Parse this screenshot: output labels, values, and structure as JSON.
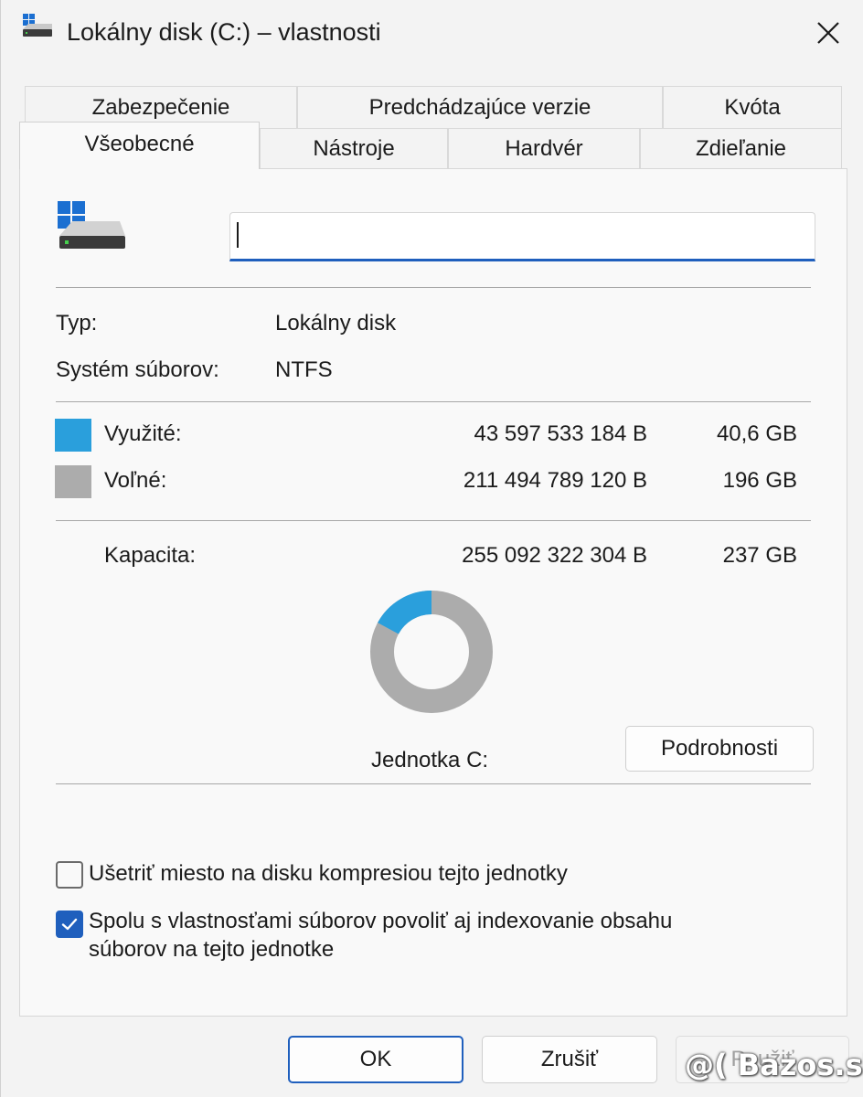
{
  "window": {
    "title": "Lokálny disk (C:) – vlastnosti"
  },
  "tabs": {
    "row1": [
      "Zabezpečenie",
      "Predchádzajúce verzie",
      "Kvóta"
    ],
    "row2": [
      "Všeobecné",
      "Nástroje",
      "Hardvér",
      "Zdieľanie"
    ],
    "active": "Všeobecné"
  },
  "general": {
    "drive_name_value": "",
    "type_label": "Typ:",
    "type_value": "Lokálny disk",
    "fs_label": "Systém súborov:",
    "fs_value": "NTFS",
    "used_label": "Využité:",
    "used_bytes": "43 597 533 184 B",
    "used_size": "40,6 GB",
    "free_label": "Voľné:",
    "free_bytes": "211 494 789 120 B",
    "free_size": "196 GB",
    "capacity_label": "Kapacita:",
    "capacity_bytes": "255 092 322 304 B",
    "capacity_size": "237 GB",
    "drive_label": "Jednotka C:",
    "details_button": "Podrobnosti",
    "used_fraction": 0.171
  },
  "options": {
    "compress_label": "Ušetriť miesto na disku kompresiou tejto jednotky",
    "compress_checked": false,
    "index_label_line1": "Spolu s vlastnosťami súborov povoliť aj indexovanie obsahu",
    "index_label_line2": "súborov na tejto jednotke",
    "index_checked": true
  },
  "buttons": {
    "ok": "OK",
    "cancel": "Zrušiť",
    "apply": "Použiť"
  },
  "watermark": "@( Bazos.sk",
  "colors": {
    "used": "#2a9fdc",
    "free": "#acacac",
    "accent": "#1f5fbd"
  }
}
